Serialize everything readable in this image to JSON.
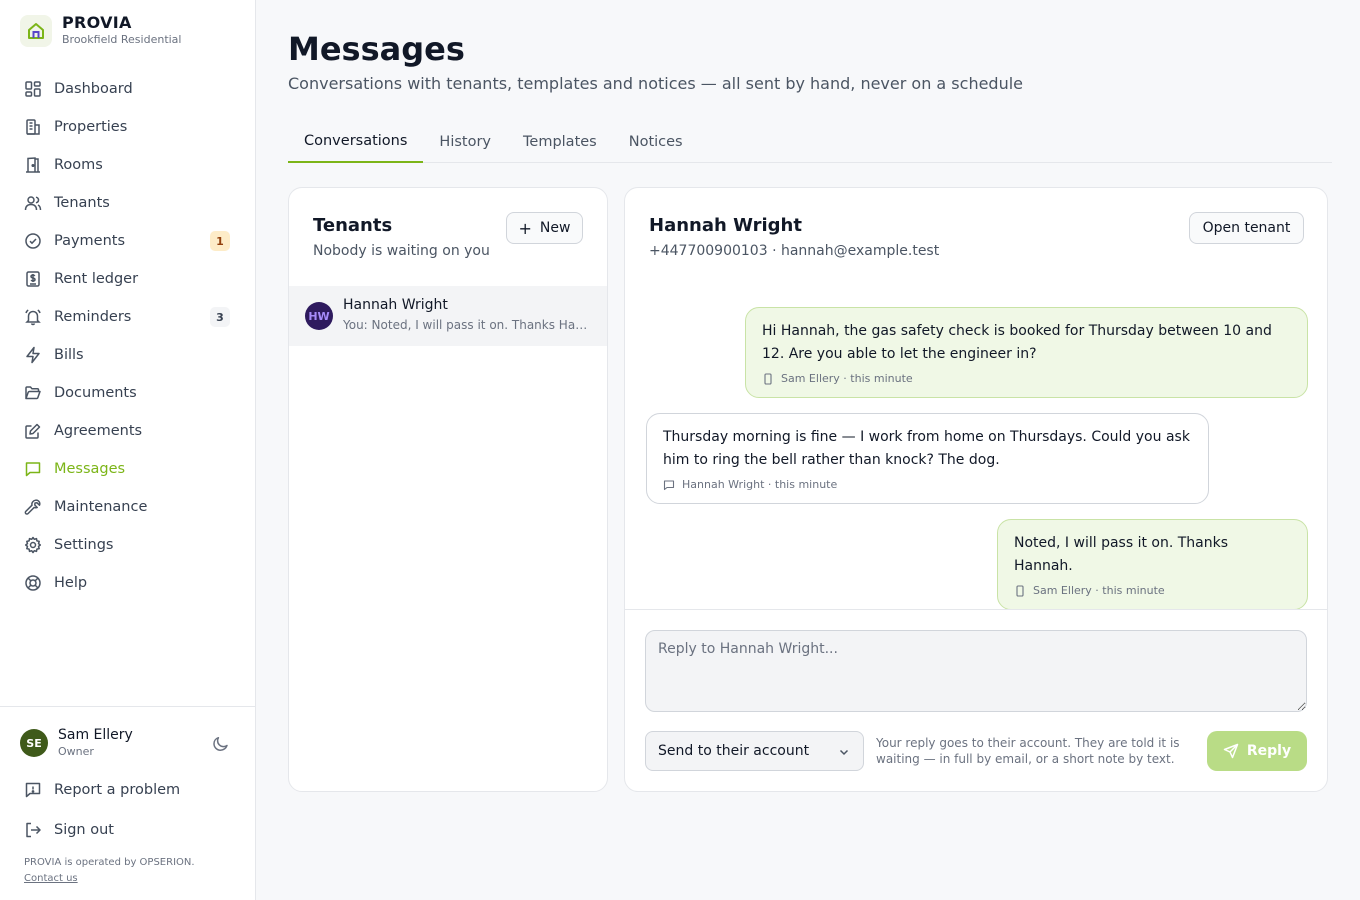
{
  "brand": {
    "name": "PROVIA",
    "subtitle": "Brookfield Residential",
    "accent": "#7cb518"
  },
  "nav": [
    {
      "label": "Dashboard",
      "icon": "dashboard-icon"
    },
    {
      "label": "Properties",
      "icon": "building-icon"
    },
    {
      "label": "Rooms",
      "icon": "door-icon"
    },
    {
      "label": "Tenants",
      "icon": "users-icon"
    },
    {
      "label": "Payments",
      "icon": "check-circle-icon",
      "badge": "1"
    },
    {
      "label": "Rent ledger",
      "icon": "ledger-icon"
    },
    {
      "label": "Reminders",
      "icon": "bell-icon",
      "badge": "3"
    },
    {
      "label": "Bills",
      "icon": "lightning-icon"
    },
    {
      "label": "Documents",
      "icon": "folder-icon"
    },
    {
      "label": "Agreements",
      "icon": "pen-square-icon"
    },
    {
      "label": "Messages",
      "icon": "chat-icon",
      "active": true
    },
    {
      "label": "Maintenance",
      "icon": "wrench-icon"
    },
    {
      "label": "Settings",
      "icon": "gear-icon"
    },
    {
      "label": "Help",
      "icon": "lifebuoy-icon"
    }
  ],
  "user": {
    "initials": "SE",
    "name": "Sam Ellery",
    "role": "Owner"
  },
  "footer": {
    "report_label": "Report a problem",
    "signout_label": "Sign out",
    "legal": "PROVIA is operated by OPSERION.",
    "contact": "Contact us"
  },
  "page": {
    "title": "Messages",
    "subtitle": "Conversations with tenants, templates and notices — all sent by hand, never on a schedule"
  },
  "tabs": [
    {
      "label": "Conversations",
      "active": true
    },
    {
      "label": "History"
    },
    {
      "label": "Templates"
    },
    {
      "label": "Notices"
    }
  ],
  "tenants_panel": {
    "title": "Tenants",
    "subtitle": "Nobody is waiting on you",
    "new_label": "New",
    "conversations": [
      {
        "initials": "HW",
        "name": "Hannah Wright",
        "preview": "You: Noted, I will pass it on. Thanks Hannah."
      }
    ]
  },
  "thread": {
    "name": "Hannah Wright",
    "contact": "+447700900103 · hannah@example.test",
    "open_label": "Open tenant",
    "messages": [
      {
        "direction": "out",
        "text": "Hi Hannah, the gas safety check is booked for Thursday between 10 and 12. Are you able to let the engineer in?",
        "meta": "Sam Ellery · this minute",
        "icon": "phone-icon"
      },
      {
        "direction": "in",
        "text": "Thursday morning is fine — I work from home on Thursdays. Could you ask him to ring the bell rather than knock? The dog.",
        "meta": "Hannah Wright · this minute",
        "icon": "chat-icon"
      },
      {
        "direction": "out",
        "text": "Noted, I will pass it on. Thanks Hannah.",
        "meta": "Sam Ellery · this minute",
        "icon": "phone-icon"
      }
    ],
    "reply_placeholder": "Reply to Hannah Wright...",
    "send_option": "Send to their account",
    "send_hint": "Your reply goes to their account. They are told it is waiting — in full by email, or a short note by text.",
    "reply_label": "Reply"
  }
}
